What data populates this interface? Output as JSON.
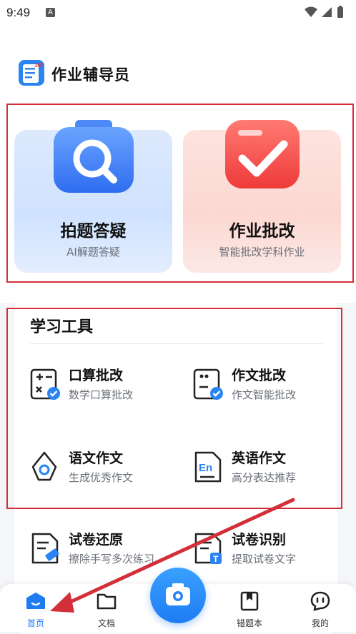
{
  "status_bar": {
    "time": "9:49",
    "badge": "A"
  },
  "app": {
    "title": "作业辅导员"
  },
  "cards": [
    {
      "title": "拍题答疑",
      "subtitle": "AI解题答疑"
    },
    {
      "title": "作业批改",
      "subtitle": "智能批改学科作业"
    }
  ],
  "tools": {
    "heading": "学习工具",
    "items": [
      {
        "title": "口算批改",
        "subtitle": "数学口算批改"
      },
      {
        "title": "作文批改",
        "subtitle": "作文智能批改"
      },
      {
        "title": "语文作文",
        "subtitle": "生成优秀作文"
      },
      {
        "title": "英语作文",
        "subtitle": "高分表达推荐"
      },
      {
        "title": "试卷还原",
        "subtitle": "擦除手写多次练习"
      },
      {
        "title": "试卷识别",
        "subtitle": "提取试卷文字"
      }
    ]
  },
  "nav": {
    "items": [
      {
        "label": "首页"
      },
      {
        "label": "文档"
      },
      {
        "label": "错题本"
      },
      {
        "label": "我的"
      }
    ]
  },
  "colors": {
    "accent": "#1e7cf3",
    "highlight_box": "#d32f3a",
    "arrow": "#d32f3a"
  }
}
